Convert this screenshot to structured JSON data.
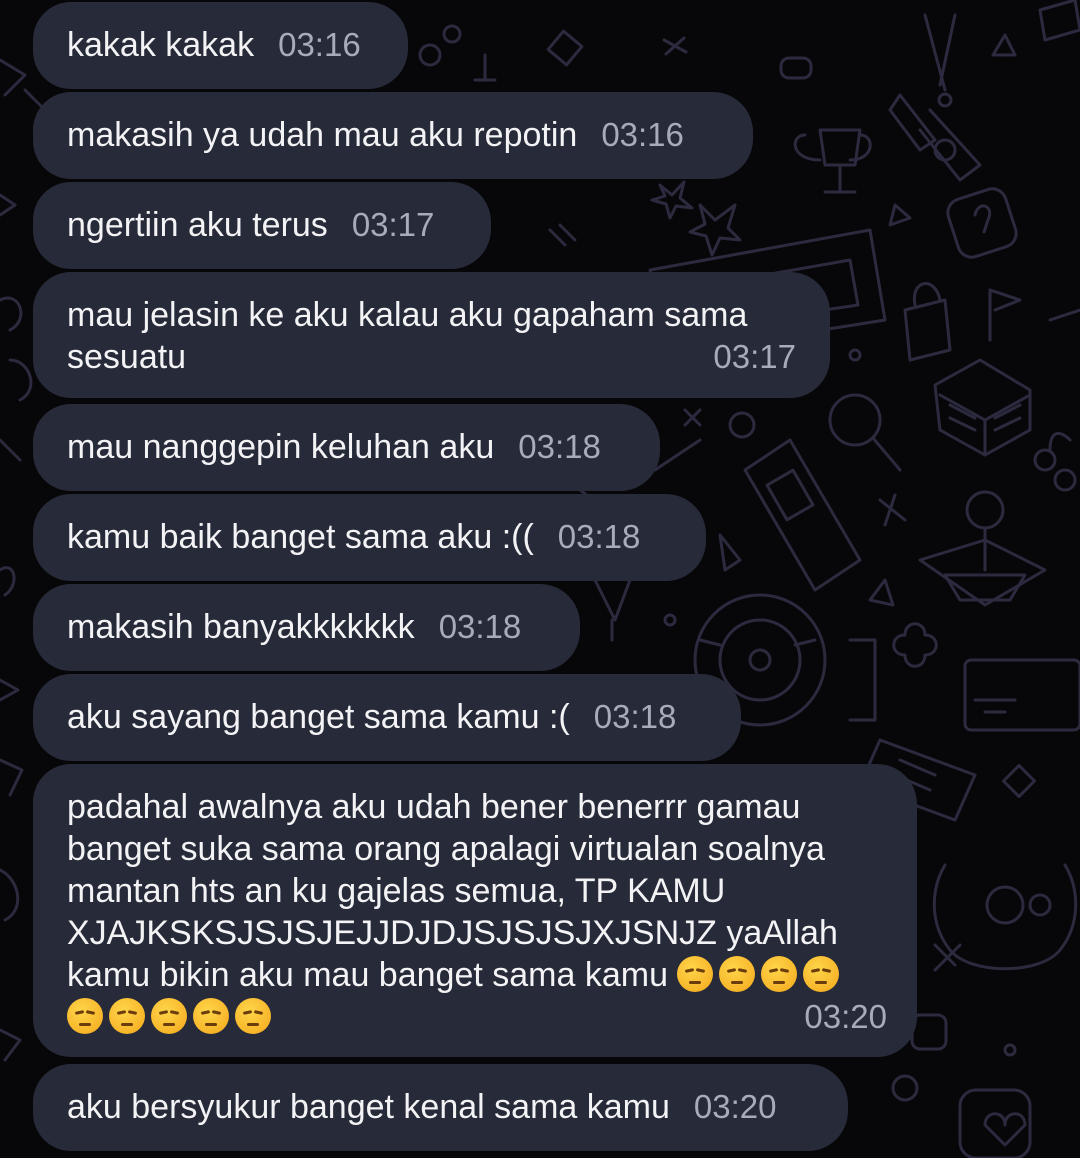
{
  "messages": [
    {
      "text": "kakak kakak",
      "time": "03:16"
    },
    {
      "text": "makasih ya udah mau aku repotin",
      "time": "03:16"
    },
    {
      "text": "ngertiin aku terus",
      "time": "03:17"
    },
    {
      "text": "mau jelasin ke aku kalau aku gapaham sama sesuatu",
      "time": "03:17"
    },
    {
      "text": "mau nanggepin keluhan aku",
      "time": "03:18"
    },
    {
      "text": "kamu baik banget sama aku :((",
      "time": "03:18"
    },
    {
      "text": "makasih banyakkkkkkk",
      "time": "03:18"
    },
    {
      "text": "aku sayang banget sama kamu :(",
      "time": "03:18"
    },
    {
      "text": "padahal awalnya aku udah bener benerrr gamau banget suka sama orang apalagi virtualan soalnya mantan hts an ku gajelas semua, TP KAMU XJAJKSKSJSJSJEJJDJDJSJSJSJXJSNJZ yaAllah kamu bikin aku mau banget sama kamu",
      "emoji": "pensive-face",
      "emoji_count": 9,
      "time": "03:20"
    },
    {
      "text": "aku bersyukur banget kenal sama kamu",
      "time": "03:20"
    }
  ],
  "colors": {
    "background": "#070709",
    "bubble": "#272a38",
    "text": "#f3f3f5",
    "time": "#a8abb8",
    "wallpaper_doodles": "#2c2a3e"
  }
}
